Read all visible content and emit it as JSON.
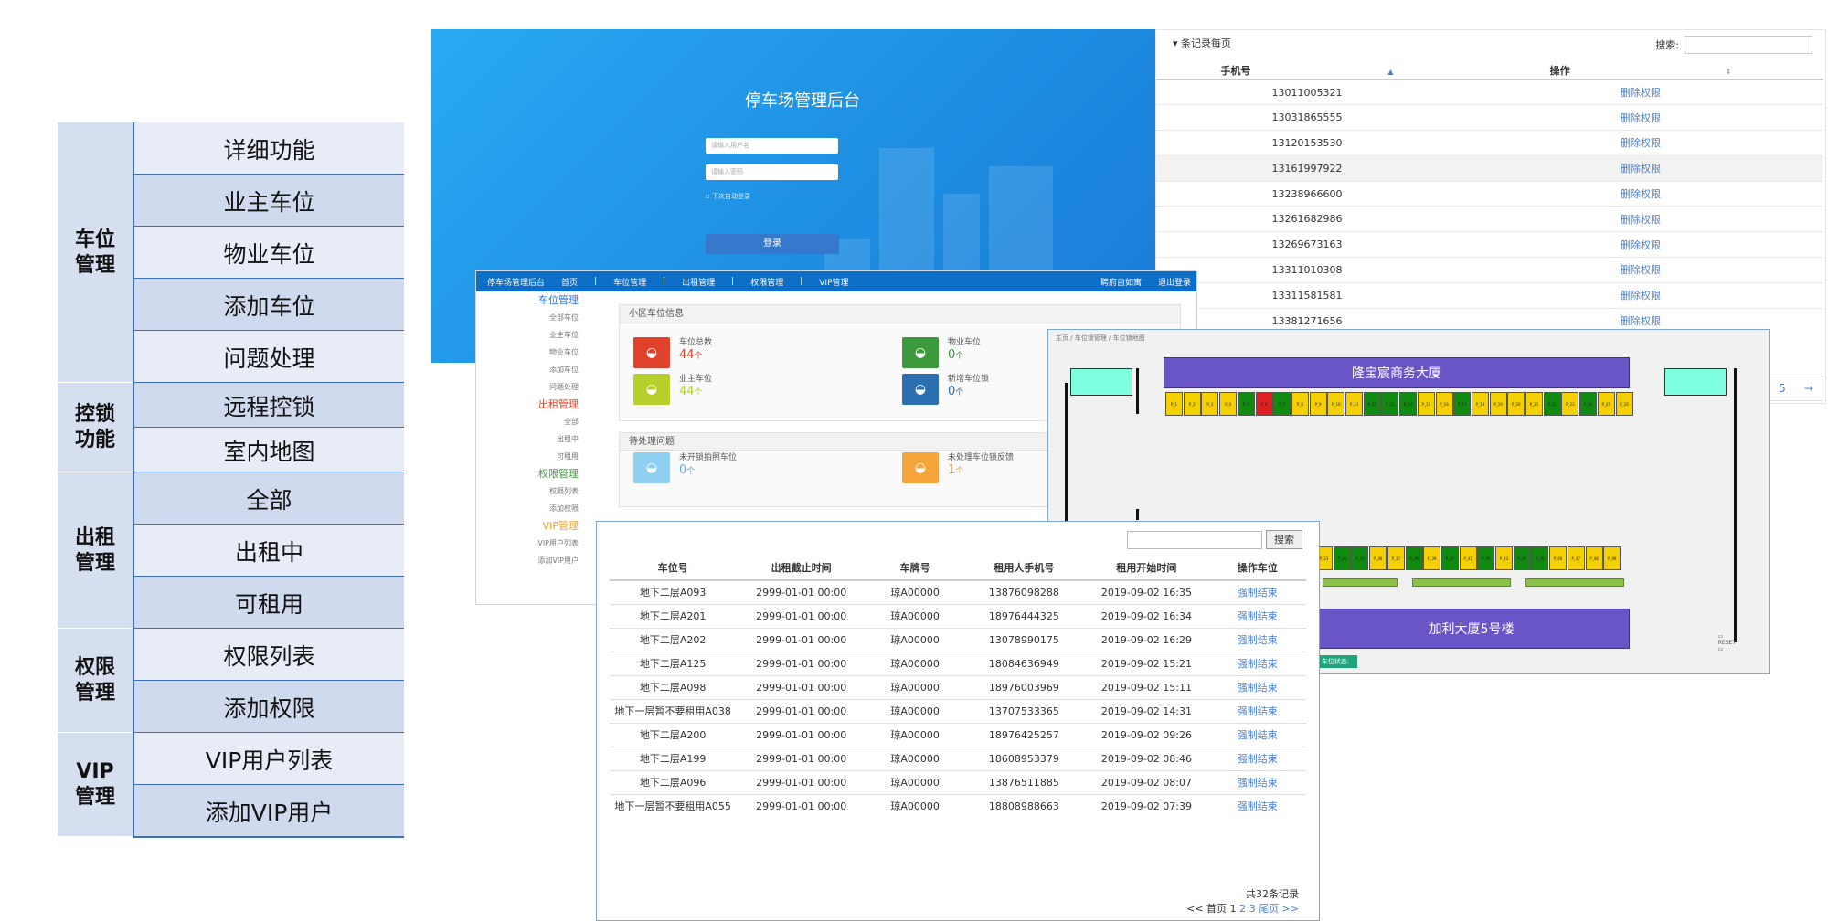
{
  "tree": {
    "groups": [
      {
        "label": "车位\n管理",
        "items": [
          "详细功能",
          "业主车位",
          "物业车位",
          "添加车位",
          "问题处理"
        ]
      },
      {
        "label": "控锁\n功能",
        "items": [
          "远程控锁",
          "室内地图"
        ]
      },
      {
        "label": "出租\n管理",
        "items": [
          "全部",
          "出租中",
          "可租用"
        ]
      },
      {
        "label": "权限\n管理",
        "items": [
          "权限列表",
          "添加权限"
        ]
      },
      {
        "label": "VIP\n管理",
        "items": [
          "VIP用户列表",
          "添加VIP用户"
        ]
      }
    ]
  },
  "login": {
    "title": "停车场管理后台",
    "username_placeholder": "请输入用户名",
    "password_placeholder": "请输入密码",
    "remember": "下次自动登录",
    "submit": "登录"
  },
  "permissions": {
    "per_page_label": "条记录每页",
    "search_label": "搜索:",
    "columns": [
      "手机号",
      "操作"
    ],
    "rows": [
      {
        "phone": "13011005321",
        "op": "删除权限"
      },
      {
        "phone": "13031865555",
        "op": "删除权限"
      },
      {
        "phone": "13120153530",
        "op": "删除权限"
      },
      {
        "phone": "13161997922",
        "op": "删除权限"
      },
      {
        "phone": "13238966600",
        "op": "删除权限"
      },
      {
        "phone": "13261682986",
        "op": "删除权限"
      },
      {
        "phone": "13269673163",
        "op": "删除权限"
      },
      {
        "phone": "13311010308",
        "op": "删除权限"
      },
      {
        "phone": "13311581581",
        "op": "删除权限"
      },
      {
        "phone": "13381271656",
        "op": "删除权限"
      }
    ],
    "page": "5",
    "next": "→"
  },
  "dashboard": {
    "nav": [
      "停车场管理后台",
      "首页",
      "|",
      "车位管理",
      "|",
      "出租管理",
      "|",
      "权限管理",
      "|",
      "VIP管理"
    ],
    "nav_right": [
      "聘府自如寓",
      "退出登录"
    ],
    "sidebar": [
      {
        "text": "车位管理",
        "type": "head",
        "color": "#2a6fd6"
      },
      {
        "text": "全部车位",
        "type": "item"
      },
      {
        "text": "业主车位",
        "type": "item"
      },
      {
        "text": "物业车位",
        "type": "item"
      },
      {
        "text": "添加车位",
        "type": "item"
      },
      {
        "text": "问题处理",
        "type": "item"
      },
      {
        "text": "出租管理",
        "type": "head",
        "color": "#e0422b"
      },
      {
        "text": "全部",
        "type": "item"
      },
      {
        "text": "出租中",
        "type": "item"
      },
      {
        "text": "可租用",
        "type": "item"
      },
      {
        "text": "权限管理",
        "type": "head",
        "color": "#3c9a3c"
      },
      {
        "text": "权限列表",
        "type": "item"
      },
      {
        "text": "添加权限",
        "type": "item"
      },
      {
        "text": "VIP管理",
        "type": "head",
        "color": "#f0a020"
      },
      {
        "text": "VIP用户列表",
        "type": "item"
      },
      {
        "text": "添加VIP用户",
        "type": "item"
      }
    ],
    "info_title": "小区车位信息",
    "stats": [
      {
        "label": "车位总数",
        "value": "44",
        "unit": "个",
        "color": "#e0422b",
        "val_color": "#e0422b"
      },
      {
        "label": "物业车位",
        "value": "0",
        "unit": "个",
        "color": "#3c9a3c",
        "val_color": "#3c9a3c"
      },
      {
        "label": "业主车位",
        "value": "44",
        "unit": "个",
        "color": "#b7cf2a",
        "val_color": "#b7cf2a"
      },
      {
        "label": "新增车位锁",
        "value": "0",
        "unit": "个",
        "color": "#2a6fb0",
        "val_color": "#2a6fb0"
      }
    ],
    "pending_title": "待处理问题",
    "pending": [
      {
        "label": "未开锁拍照车位",
        "value": "0",
        "unit": "个",
        "color": "#8fd0f0",
        "val_color": "#5aaee0"
      },
      {
        "label": "未处理车位锁反馈",
        "value": "1",
        "unit": "个",
        "color": "#f5a53a",
        "val_color": "#f5a53a"
      }
    ]
  },
  "map": {
    "breadcrumb": "主页 / 车位锁管理 / 车位锁地图",
    "building_top": "隆宝宸商务大厦",
    "building_bottom": "加利大厦5号楼",
    "status_button": "车位状态:",
    "reset": "RESET",
    "colors": {
      "free": "#f5d000",
      "occupied": "#118a11",
      "alert": "#e02020"
    },
    "top_row": [
      {
        "id": "P_1",
        "s": "free"
      },
      {
        "id": "P_2",
        "s": "free"
      },
      {
        "id": "P_3",
        "s": "free"
      },
      {
        "id": "P_4",
        "s": "free"
      },
      {
        "id": "P_5",
        "s": "occupied"
      },
      {
        "id": "P_6",
        "s": "alert"
      },
      {
        "id": "P_7",
        "s": "occupied"
      },
      {
        "id": "P_8",
        "s": "free"
      },
      {
        "id": "P_9",
        "s": "free"
      },
      {
        "id": "P_10",
        "s": "free"
      },
      {
        "id": "P_11",
        "s": "free"
      },
      {
        "id": "P_12",
        "s": "occupied"
      },
      {
        "id": "P_13",
        "s": "occupied"
      },
      {
        "id": "P_14",
        "s": "occupied"
      },
      {
        "id": "P_15",
        "s": "free"
      },
      {
        "id": "P_16",
        "s": "free"
      },
      {
        "id": "P_17",
        "s": "occupied"
      },
      {
        "id": "P_18",
        "s": "free"
      },
      {
        "id": "P_19",
        "s": "free"
      },
      {
        "id": "P_20",
        "s": "free"
      },
      {
        "id": "P_21",
        "s": "free"
      },
      {
        "id": "P_22",
        "s": "occupied"
      },
      {
        "id": "P_23",
        "s": "free"
      },
      {
        "id": "P_24",
        "s": "occupied"
      },
      {
        "id": "P_25",
        "s": "free"
      },
      {
        "id": "P_26",
        "s": "free"
      }
    ],
    "bottom_row": [
      {
        "id": "P_33",
        "s": "free"
      },
      {
        "id": "P_34",
        "s": "occupied"
      },
      {
        "id": "P_35",
        "s": "occupied"
      },
      {
        "id": "P_36",
        "s": "free"
      },
      {
        "id": "P_37",
        "s": "free"
      },
      {
        "id": "P_38",
        "s": "occupied"
      },
      {
        "id": "P_39",
        "s": "free"
      },
      {
        "id": "P_40",
        "s": "occupied"
      },
      {
        "id": "P_41",
        "s": "free"
      },
      {
        "id": "P_42",
        "s": "occupied"
      },
      {
        "id": "P_43",
        "s": "free"
      },
      {
        "id": "P_44",
        "s": "occupied"
      },
      {
        "id": "P_45",
        "s": "occupied"
      },
      {
        "id": "P_46",
        "s": "free"
      },
      {
        "id": "P_47",
        "s": "free"
      },
      {
        "id": "P_48",
        "s": "free"
      },
      {
        "id": "P_49",
        "s": "free"
      }
    ]
  },
  "rentals": {
    "search_button": "搜索",
    "columns": [
      "车位号",
      "出租截止时间",
      "车牌号",
      "租用人手机号",
      "租用开始时间",
      "操作车位"
    ],
    "rows": [
      [
        "地下二层A093",
        "2999-01-01 00:00",
        "琼A00000",
        "13876098288",
        "2019-09-02 16:35",
        "强制结束"
      ],
      [
        "地下二层A201",
        "2999-01-01 00:00",
        "琼A00000",
        "18976444325",
        "2019-09-02 16:34",
        "强制结束"
      ],
      [
        "地下二层A202",
        "2999-01-01 00:00",
        "琼A00000",
        "13078990175",
        "2019-09-02 16:29",
        "强制结束"
      ],
      [
        "地下二层A125",
        "2999-01-01 00:00",
        "琼A00000",
        "18084636949",
        "2019-09-02 15:21",
        "强制结束"
      ],
      [
        "地下二层A098",
        "2999-01-01 00:00",
        "琼A00000",
        "18976003969",
        "2019-09-02 15:11",
        "强制结束"
      ],
      [
        "地下一层暂不要租用A038",
        "2999-01-01 00:00",
        "琼A00000",
        "13707533365",
        "2019-09-02 14:31",
        "强制结束"
      ],
      [
        "地下二层A200",
        "2999-01-01 00:00",
        "琼A00000",
        "18976425257",
        "2019-09-02 09:26",
        "强制结束"
      ],
      [
        "地下二层A199",
        "2999-01-01 00:00",
        "琼A00000",
        "18608953379",
        "2019-09-02 08:46",
        "强制结束"
      ],
      [
        "地下二层A096",
        "2999-01-01 00:00",
        "琼A00000",
        "13876511885",
        "2019-09-02 08:07",
        "强制结束"
      ],
      [
        "地下一层暂不要租用A055",
        "2999-01-01 00:00",
        "琼A00000",
        "18808988663",
        "2019-09-02 07:39",
        "强制结束"
      ]
    ],
    "total": "共32条记录",
    "pager": {
      "first": "<< 首页",
      "p1": "1",
      "p2": "2",
      "p3": "3",
      "last": "尾页 >>"
    }
  }
}
